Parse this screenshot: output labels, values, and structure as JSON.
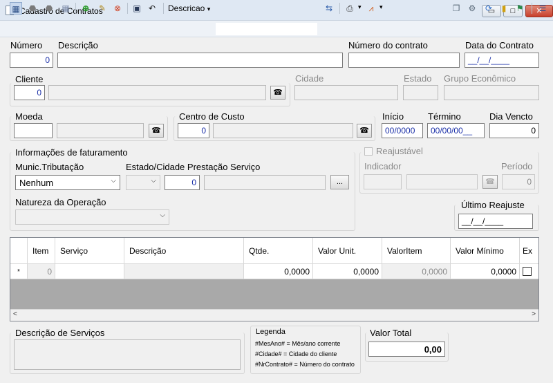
{
  "window": {
    "title": "Cadastro de Contratos",
    "minimize_glyph": "▭",
    "maximize_glyph": "□",
    "close_glyph": "✕"
  },
  "toolbar": {
    "view_dropdown": "Descricao",
    "caret": "▾",
    "icons": [
      "grid-view-icon",
      "first-record-icon",
      "previous-record-icon",
      "last-record-icon",
      "add-icon",
      "edit-icon",
      "delete-icon",
      "save-icon",
      "undo-icon",
      "export-icon",
      "print-icon",
      "chart-icon",
      "window-icon",
      "settings-icon",
      "refresh-icon",
      "bookmark-icon",
      "map-icon",
      "menu-icon"
    ]
  },
  "form": {
    "numero": {
      "label": "Número",
      "value": "0"
    },
    "descricao": {
      "label": "Descrição",
      "value": ""
    },
    "numero_contrato": {
      "label": "Número do contrato",
      "value": ""
    },
    "data_contrato": {
      "label": "Data do Contrato",
      "value": "__/__/____"
    },
    "cliente": {
      "label": "Cliente",
      "value": "0",
      "name": ""
    },
    "cidade": {
      "label": "Cidade",
      "value": ""
    },
    "estado": {
      "label": "Estado",
      "value": ""
    },
    "grupo_economico": {
      "label": "Grupo Econômico",
      "value": ""
    },
    "moeda": {
      "label": "Moeda",
      "value": "",
      "name": ""
    },
    "centro_custo": {
      "label": "Centro de Custo",
      "value": "0",
      "name": ""
    },
    "inicio": {
      "label": "Início",
      "value": "00/0000"
    },
    "termino": {
      "label": "Término",
      "value": "00/00/00__"
    },
    "dia_vencto": {
      "label": "Dia Vencto",
      "value": "0"
    },
    "faturamento": {
      "group_label": "Informações de faturamento",
      "munic_tributacao": {
        "label": "Munic.Tributação",
        "value": "Nenhum"
      },
      "estado_cidade": {
        "label": "Estado/Cidade Prestação Serviço",
        "value": "",
        "code": "0",
        "name": ""
      },
      "ellipsis": "...",
      "natureza": {
        "label": "Natureza da Operação",
        "value": ""
      }
    },
    "reajuste": {
      "reajustavel_label": "Reajustável",
      "indicador": {
        "label": "Indicador",
        "value": "",
        "name": ""
      },
      "periodo": {
        "label": "Período",
        "value": "0"
      },
      "ultimo_reajuste": {
        "label": "Último Reajuste",
        "value": "__/__/____"
      }
    }
  },
  "grid": {
    "columns": [
      "Item",
      "Serviço",
      "Descrição",
      "Qtde.",
      "Valor Unit.",
      "ValorItem",
      "Valor Mínimo",
      "Ex"
    ],
    "new_row_marker": "*",
    "row": {
      "item": "0",
      "servico": "",
      "descricao": "",
      "qtde": "0,0000",
      "valor_unit": "0,0000",
      "valor_item": "0,0000",
      "valor_minimo": "0,0000"
    }
  },
  "footer": {
    "descricao_servicos": {
      "label": "Descrição de Serviços",
      "value": ""
    },
    "legenda": {
      "title": "Legenda",
      "lines": [
        "#MesAno# = Mês/ano corrente",
        "#Cidade# = Cidade do cliente",
        "#NrContrato# = Número do contrato"
      ]
    },
    "valor_total": {
      "label": "Valor Total",
      "value": "0,00"
    }
  },
  "colors": {
    "titlebar": "#dfe8f3",
    "field_text_blue": "#1a2fa8",
    "grid_empty": "#a9a9a9"
  }
}
